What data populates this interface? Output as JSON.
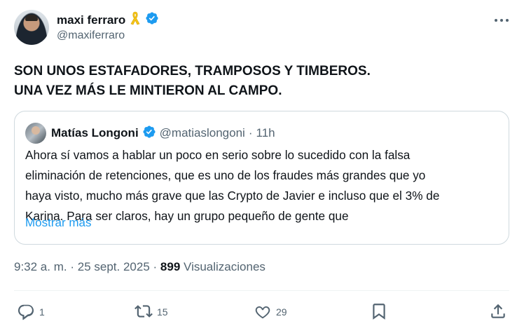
{
  "author": {
    "display_name": "maxi ferraro",
    "handle": "@maxiferraro",
    "ribbon_emoji": "yellow-ribbon-icon",
    "verified": "verified-badge-icon"
  },
  "tweet": {
    "lines": [
      "SON UNOS ESTAFADORES, TRAMPOSOS Y TIMBEROS.",
      "UNA VEZ MÁS LE MINTIERON AL CAMPO."
    ]
  },
  "quote": {
    "display_name": "Matías Longoni",
    "handle": "@matiaslongoni",
    "separator": "·",
    "time": "11h",
    "text_lines": [
      "Ahora sí vamos a hablar un poco en serio sobre lo sucedido con la falsa",
      "eliminación de retenciones, que es uno de los fraudes más grandes que yo",
      "haya visto, mucho más grave que las Crypto de Javier e incluso que el 3% de",
      "Karina. Para ser claros, hay un grupo pequeño de gente que"
    ],
    "show_more": "Mostrar más"
  },
  "meta": {
    "time": "9:32 a. m.",
    "sep1": "·",
    "date": "25 sept. 2025",
    "sep2": "·",
    "views": "899",
    "views_label": "Visualizaciones"
  },
  "actions": {
    "replies": "1",
    "retweets": "15",
    "likes": "29"
  },
  "colors": {
    "accent": "#1d9bf0",
    "secondary_text": "#536471",
    "primary_text": "#0f1419",
    "border": "#cfd9de",
    "ribbon": "#f5c518"
  }
}
